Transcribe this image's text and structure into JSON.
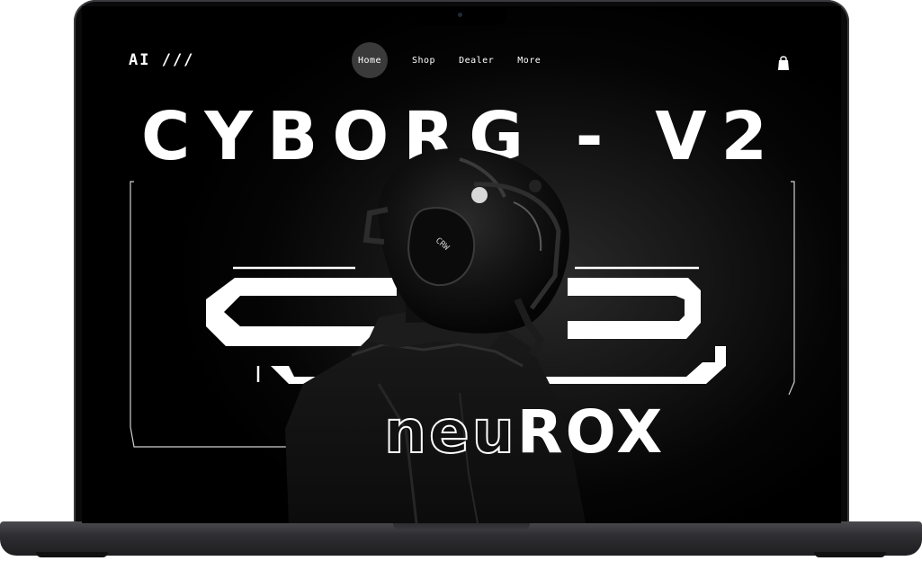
{
  "brand": {
    "logo": "AI ///",
    "headline": "CYBORG - V2",
    "wordmark_outline": "neu",
    "wordmark_solid": "ROX"
  },
  "nav": {
    "items": [
      {
        "label": "Home",
        "active": true
      },
      {
        "label": "Shop",
        "active": false
      },
      {
        "label": "Dealer",
        "active": false
      },
      {
        "label": "More",
        "active": false
      }
    ]
  },
  "icons": {
    "cart": "shopping-bag-icon"
  },
  "colors": {
    "background": "#000000",
    "text": "#ffffff",
    "active_pill": "#3a3a3a",
    "device_frame": "#2f2f33"
  }
}
